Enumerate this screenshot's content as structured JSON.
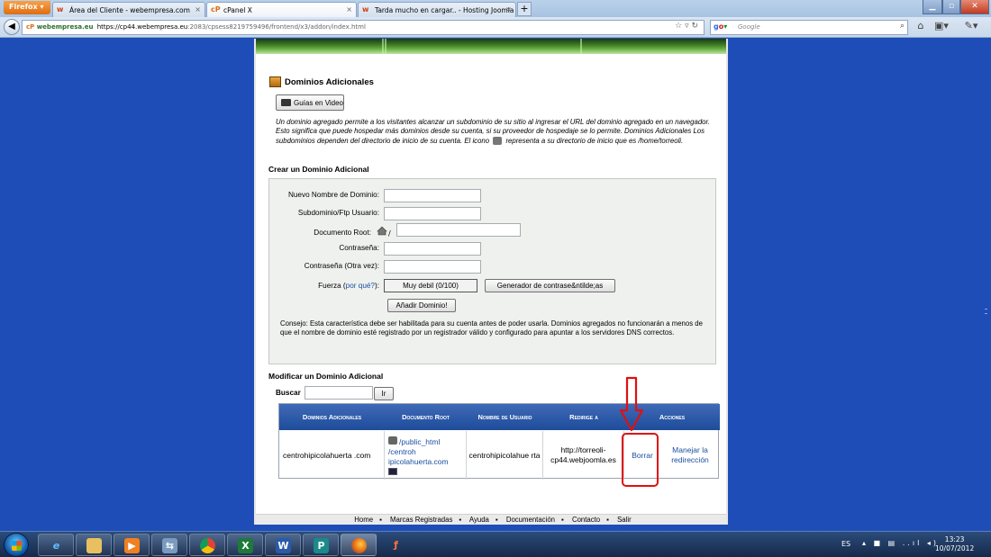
{
  "browser": {
    "menu_button": "Firefox",
    "tabs": [
      {
        "label": "Área del Cliente - webempresa.com",
        "active": false
      },
      {
        "label": "cPanel X",
        "active": true
      },
      {
        "label": "Tarda mucho en cargar.. - Hosting Joomla",
        "active": false
      }
    ],
    "new_tab": "+",
    "url_site": "webempresa.eu",
    "url_host": "https://cp44.webempresa.eu",
    "url_path": ":2083/cpsess8219759496/frontend/x3/addon/index.html",
    "search_placeholder": "Google"
  },
  "page": {
    "section_title": "Dominios Adicionales",
    "video_button": "Guías en Video",
    "intro_text_1": "Un dominio agregado permite a los visitantes alcanzar un subdominio de su sitio al ingresar el URL del dominio agregado en un navegador. Esto significa que puede hospedar más dominios desde su cuenta, si su proveedor de hospedaje se lo permite. Dominios Adicionales Los subdominios dependen del directorio de inicio de su cuenta. El icono",
    "intro_text_2": "representa a su directorio de inicio que es /home/torreoli.",
    "create_title": "Crear un Dominio Adicional",
    "form": {
      "new_domain_label": "Nuevo Nombre de Dominio:",
      "subdomain_label": "Subdominio/Ftp Usuario:",
      "root_label": "Documento Root:",
      "root_slash": "/",
      "password_label": "Contraseña:",
      "password_again_label": "Contraseña (Otra vez):",
      "strength_label": "Fuerza (",
      "strength_link": "por qué?",
      "strength_close": "):",
      "strength_value": "Muy debil (0/100)",
      "generator_button": "Generador de contrase&ntilde;as",
      "add_button": "Añadir Dominio!"
    },
    "tip": "Consejo: Esta característica debe ser habilitada para su cuenta antes de poder usarla. Dominios agregados no funcionarán a menos de que el nombre de dominio esté registrado por un registrador válido y configurado para apuntar a los servidores DNS correctos.",
    "modify_title": "Modificar un Dominio Adicional",
    "search_label": "Buscar",
    "search_button": "Ir",
    "table": {
      "headers": [
        "Dominios Adicionales",
        "Documento Root",
        "Nombre de Usuario",
        "Redirige a",
        "Acciones"
      ],
      "row": {
        "domain": "centrohipicolahuerta .com",
        "doc_root": "/public_html /centroh ipicolahuerta.com",
        "username": "centrohipicolahue rta",
        "redirect": "http://torreoli-cp44.webjoomla.es",
        "delete": "Borrar",
        "manage_redirect": "Manejar la redirección"
      }
    },
    "footer": [
      "Home",
      "Marcas Registradas",
      "Ayuda",
      "Documentación",
      "Contacto",
      "Salir"
    ]
  },
  "taskbar": {
    "language": "ES",
    "time": "13:23",
    "date": "10/07/2012"
  },
  "colors": {
    "header_blue": "#1f4d9a",
    "link_blue": "#1a4fa0",
    "annotation_red": "#e01010",
    "desktop_blue": "#1f4db8"
  }
}
